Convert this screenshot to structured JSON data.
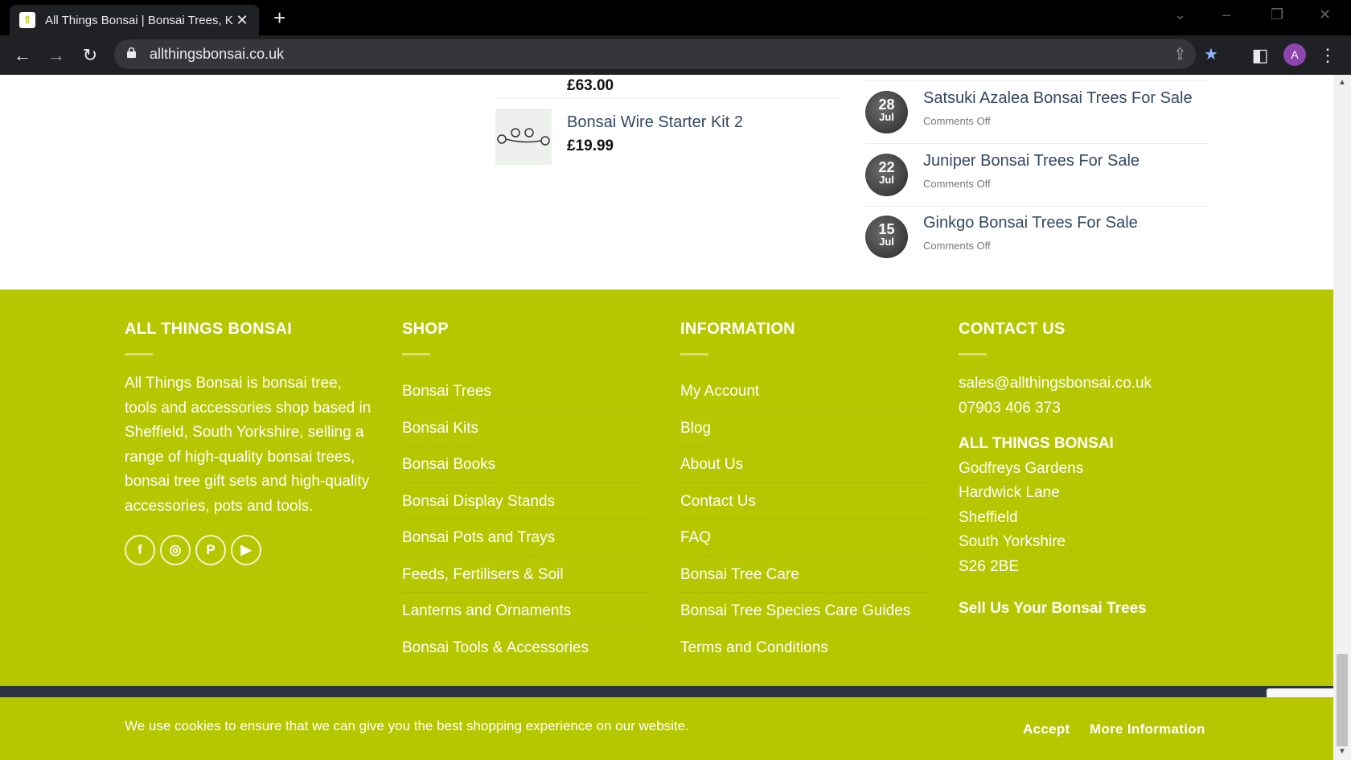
{
  "browser": {
    "tab_title": "All Things Bonsai | Bonsai Trees, K",
    "tab_close": "✕",
    "new_tab": "+",
    "url": "allthingsbonsai.co.uk",
    "avatar_letter": "A"
  },
  "products": [
    {
      "name": "",
      "price": "£63.00"
    },
    {
      "name": "Bonsai Wire Starter Kit 2",
      "price": "£19.99"
    }
  ],
  "posts": [
    {
      "day": "28",
      "month": "Jul",
      "title": "Satsuki Azalea Bonsai Trees For Sale",
      "meta": "Comments Off"
    },
    {
      "day": "22",
      "month": "Jul",
      "title": "Juniper Bonsai Trees For Sale",
      "meta": "Comments Off"
    },
    {
      "day": "15",
      "month": "Jul",
      "title": "Ginkgo Bonsai Trees For Sale",
      "meta": "Comments Off"
    }
  ],
  "footer": {
    "about": {
      "heading": "ALL THINGS BONSAI",
      "text": "All Things Bonsai is bonsai tree, tools and accessories shop based in Sheffield, South Yorkshire, selling a range of high-quality bonsai trees, bonsai tree gift sets and high-quality accessories, pots and tools.",
      "social": [
        "f",
        "◎",
        "P",
        "▶"
      ]
    },
    "shop": {
      "heading": "SHOP",
      "links": [
        "Bonsai Trees",
        "Bonsai Kits",
        "Bonsai Books",
        "Bonsai Display Stands",
        "Bonsai Pots and Trays",
        "Feeds, Fertilisers & Soil",
        "Lanterns and Ornaments",
        "Bonsai Tools & Accessories"
      ]
    },
    "info": {
      "heading": "INFORMATION",
      "links": [
        "My Account",
        "Blog",
        "About Us",
        "Contact Us",
        "FAQ",
        "Bonsai Tree Care",
        "Bonsai Tree Species Care Guides",
        "Terms and Conditions"
      ]
    },
    "contact": {
      "heading": "CONTACT US",
      "email": "sales@allthingsbonsai.co.uk",
      "phone": "07903 406 373",
      "company": "ALL THINGS BONSAI",
      "address": [
        "Godfreys Gardens",
        "Hardwick Lane",
        "Sheffield",
        "South Yorkshire",
        "S26 2BE"
      ],
      "sell": "Sell Us Your Bonsai Trees"
    }
  },
  "cookie": {
    "message": "We use cookies to ensure that we can give you the best shopping experience on our website.",
    "accept": "Accept",
    "more": "More Information"
  },
  "colors": {
    "footer_bg": "#b6c700",
    "link_blue": "#334862"
  }
}
